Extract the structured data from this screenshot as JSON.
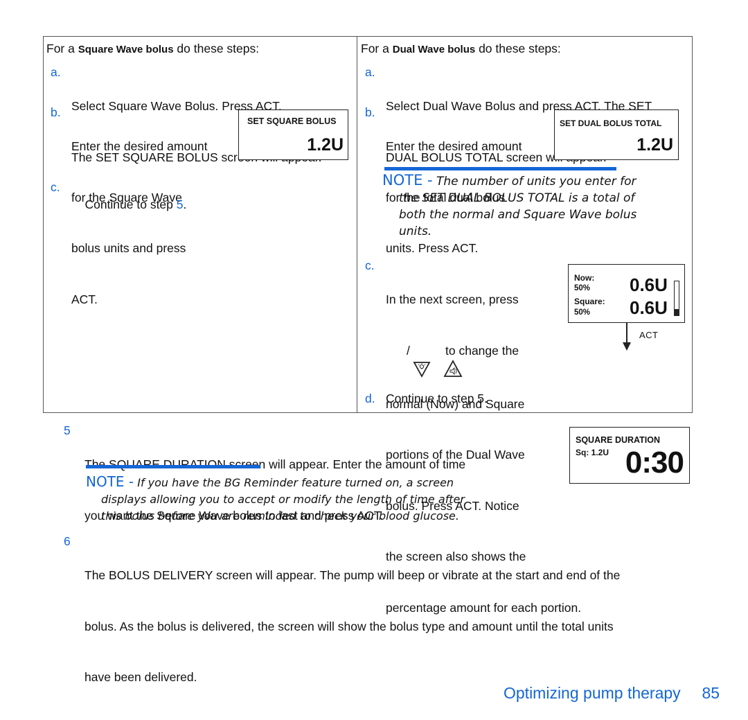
{
  "square_column": {
    "lead_prefix": "For a",
    "lead_bold": "Square Wave bolus",
    "lead_suffix": "do these steps:",
    "steps": [
      {
        "label": "a.",
        "lines": [
          "Select Square Wave Bolus. Press ACT.",
          "The SET SQUARE BOLUS screen will appear."
        ]
      },
      {
        "label": "b.",
        "lines": [
          "Enter the desired amount",
          "for the Square Wave",
          "bolus units and press",
          "ACT."
        ]
      },
      {
        "label": "c.",
        "text_before": "Continue to step ",
        "link": "5",
        "text_after": "."
      }
    ],
    "screen": {
      "title": "SET SQUARE BOLUS",
      "value": "1.2U"
    }
  },
  "dual_column": {
    "lead_prefix": "For a",
    "lead_bold": "Dual Wave bolus",
    "lead_suffix": "do these steps:",
    "steps": [
      {
        "label": "a.",
        "lines": [
          "Select Dual Wave Bolus and press ACT. The SET",
          "DUAL BOLUS TOTAL screen will appear."
        ]
      },
      {
        "label": "b.",
        "lines": [
          "Enter the desired amount",
          "for the total dual bolus",
          "units. Press ACT."
        ]
      },
      {
        "label": "c.",
        "line1": "In the next screen, press",
        "line2_suffix": "to change the",
        "lines_rest": [
          "normal (Now) and Square",
          "portions of the Dual Wave",
          "bolus. Press ACT. Notice",
          "the screen also shows the",
          "percentage amount for each portion."
        ],
        "icon_separator": "/"
      },
      {
        "label": "d.",
        "text": "Continue to step 5."
      }
    ],
    "screen": {
      "title": "SET DUAL BOLUS TOTAL",
      "value": "1.2U"
    },
    "note": {
      "prefix": "NOTE -",
      "lines": [
        "The number of units you enter for",
        "the SET DUAL BOLUS TOTAL is a total of",
        "both the normal and Square Wave bolus",
        "units."
      ]
    },
    "split_screen": {
      "now_label": "Now:",
      "now_pct": "50%",
      "now_value": "0.6U",
      "square_label": "Square:",
      "square_pct": "50%",
      "square_value": "0.6U",
      "arrow_label": "ACT"
    }
  },
  "step5": {
    "number": "5",
    "lines": [
      "The SQUARE DURATION screen will appear. Enter the amount of time",
      "you want the Square Wave bolus to last and press ACT."
    ],
    "screen": {
      "title": "SQUARE DURATION",
      "sub": "Sq: 1.2U",
      "value": "0:30"
    },
    "note": {
      "prefix": "NOTE -",
      "lines": [
        "If you have the BG Reminder feature turned on, a screen",
        "displays allowing you to accept or modify the length of time after",
        "this bolus before you are reminded to check your blood glucose."
      ]
    }
  },
  "step6": {
    "number": "6",
    "lines": [
      "The BOLUS DELIVERY screen will appear. The pump will beep or vibrate at the start and end of the",
      "bolus. As the bolus is delivered, the screen will show the bolus type and amount until the total units",
      "have been delivered."
    ]
  },
  "footer": {
    "section": "Optimizing pump therapy",
    "page": "85"
  },
  "colors": {
    "accent": "#1466d6",
    "text": "#111111",
    "border": "#555555"
  }
}
